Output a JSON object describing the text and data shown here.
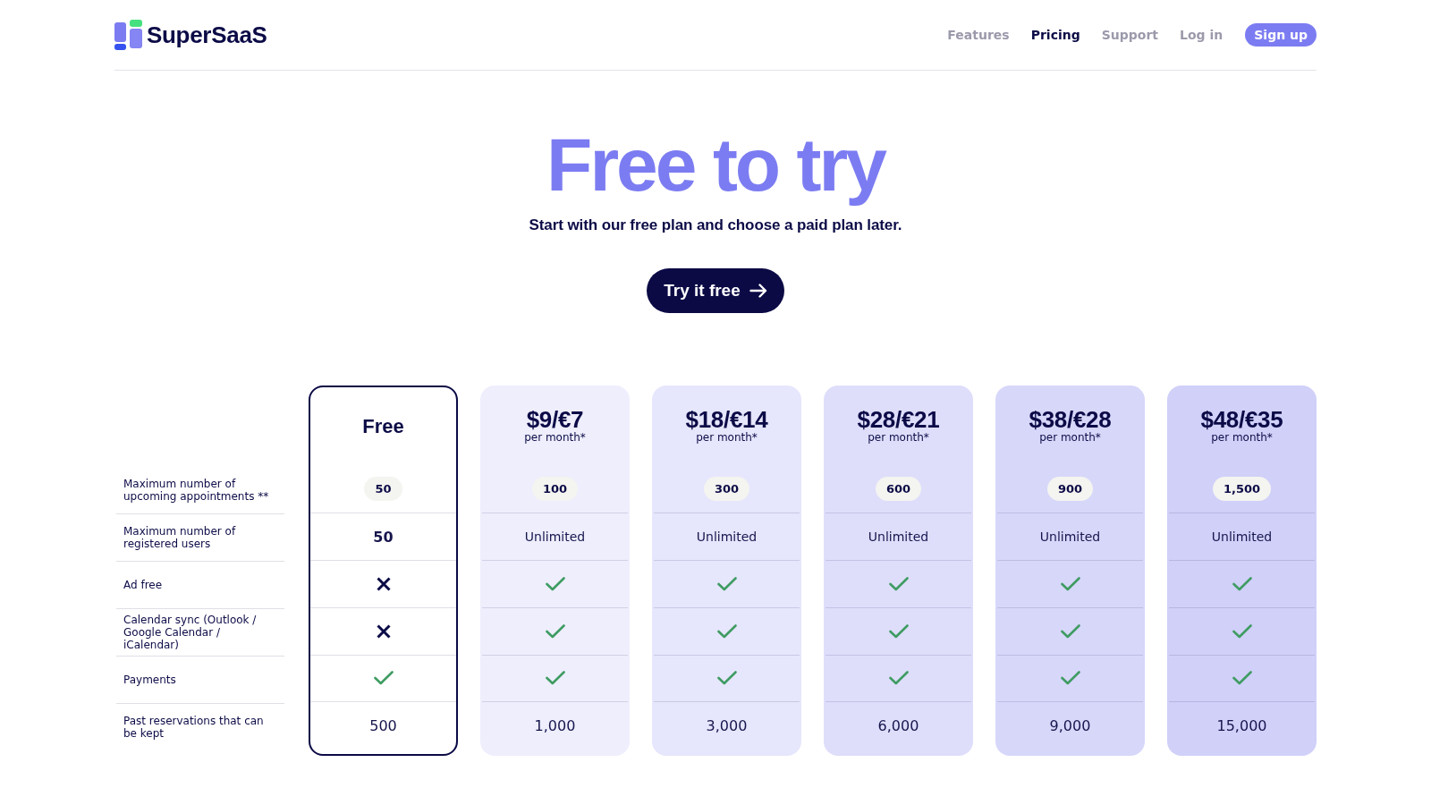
{
  "header": {
    "brand": "SuperSaaS",
    "nav": [
      {
        "label": "Features",
        "selected": false
      },
      {
        "label": "Pricing",
        "selected": true
      },
      {
        "label": "Support",
        "selected": false
      },
      {
        "label": "Log in",
        "selected": false
      }
    ],
    "sign_up": "Sign up"
  },
  "hero": {
    "title": "Free to try",
    "subtitle": "Start with our free plan and choose a paid plan later.",
    "button": "Try it free"
  },
  "pricing": {
    "features": [
      "Maximum number of upcoming appointments **",
      "Maximum number of registered users",
      "Ad free",
      "Calendar sync (Outlook / Google Calendar / iCalendar)",
      "Payments",
      "Past reservations that can be kept"
    ],
    "plans": [
      {
        "name": "Free",
        "highlighted": true,
        "color": "#ffffff",
        "cells": [
          {
            "kind": "badge",
            "text": "50"
          },
          {
            "kind": "strong",
            "text": "50"
          },
          {
            "kind": "cross"
          },
          {
            "kind": "cross"
          },
          {
            "kind": "check"
          },
          {
            "kind": "large",
            "text": "500"
          }
        ]
      },
      {
        "price": "$9/€7",
        "period": "per month*",
        "highlighted": false,
        "color": "#eeeefd",
        "cells": [
          {
            "kind": "badge",
            "text": "100"
          },
          {
            "kind": "plain",
            "text": "Unlimited"
          },
          {
            "kind": "check"
          },
          {
            "kind": "check"
          },
          {
            "kind": "check"
          },
          {
            "kind": "large",
            "text": "1,000"
          }
        ]
      },
      {
        "price": "$18/€14",
        "period": "per month*",
        "highlighted": false,
        "color": "#e6e6fc",
        "cells": [
          {
            "kind": "badge",
            "text": "300"
          },
          {
            "kind": "plain",
            "text": "Unlimited"
          },
          {
            "kind": "check"
          },
          {
            "kind": "check"
          },
          {
            "kind": "check"
          },
          {
            "kind": "large",
            "text": "3,000"
          }
        ]
      },
      {
        "price": "$28/€21",
        "period": "per month*",
        "highlighted": false,
        "color": "#dedefb",
        "cells": [
          {
            "kind": "badge",
            "text": "600"
          },
          {
            "kind": "plain",
            "text": "Unlimited"
          },
          {
            "kind": "check"
          },
          {
            "kind": "check"
          },
          {
            "kind": "check"
          },
          {
            "kind": "large",
            "text": "6,000"
          }
        ]
      },
      {
        "price": "$38/€28",
        "period": "per month*",
        "highlighted": false,
        "color": "#d7d7fa",
        "cells": [
          {
            "kind": "badge",
            "text": "900"
          },
          {
            "kind": "plain",
            "text": "Unlimited"
          },
          {
            "kind": "check"
          },
          {
            "kind": "check"
          },
          {
            "kind": "check"
          },
          {
            "kind": "large",
            "text": "9,000"
          }
        ]
      },
      {
        "price": "$48/€35",
        "period": "per month*",
        "highlighted": false,
        "color": "#d0d0f9",
        "cells": [
          {
            "kind": "badge",
            "text": "1,500"
          },
          {
            "kind": "plain",
            "text": "Unlimited"
          },
          {
            "kind": "check"
          },
          {
            "kind": "check"
          },
          {
            "kind": "check"
          },
          {
            "kind": "large",
            "text": "15,000"
          }
        ]
      }
    ]
  }
}
